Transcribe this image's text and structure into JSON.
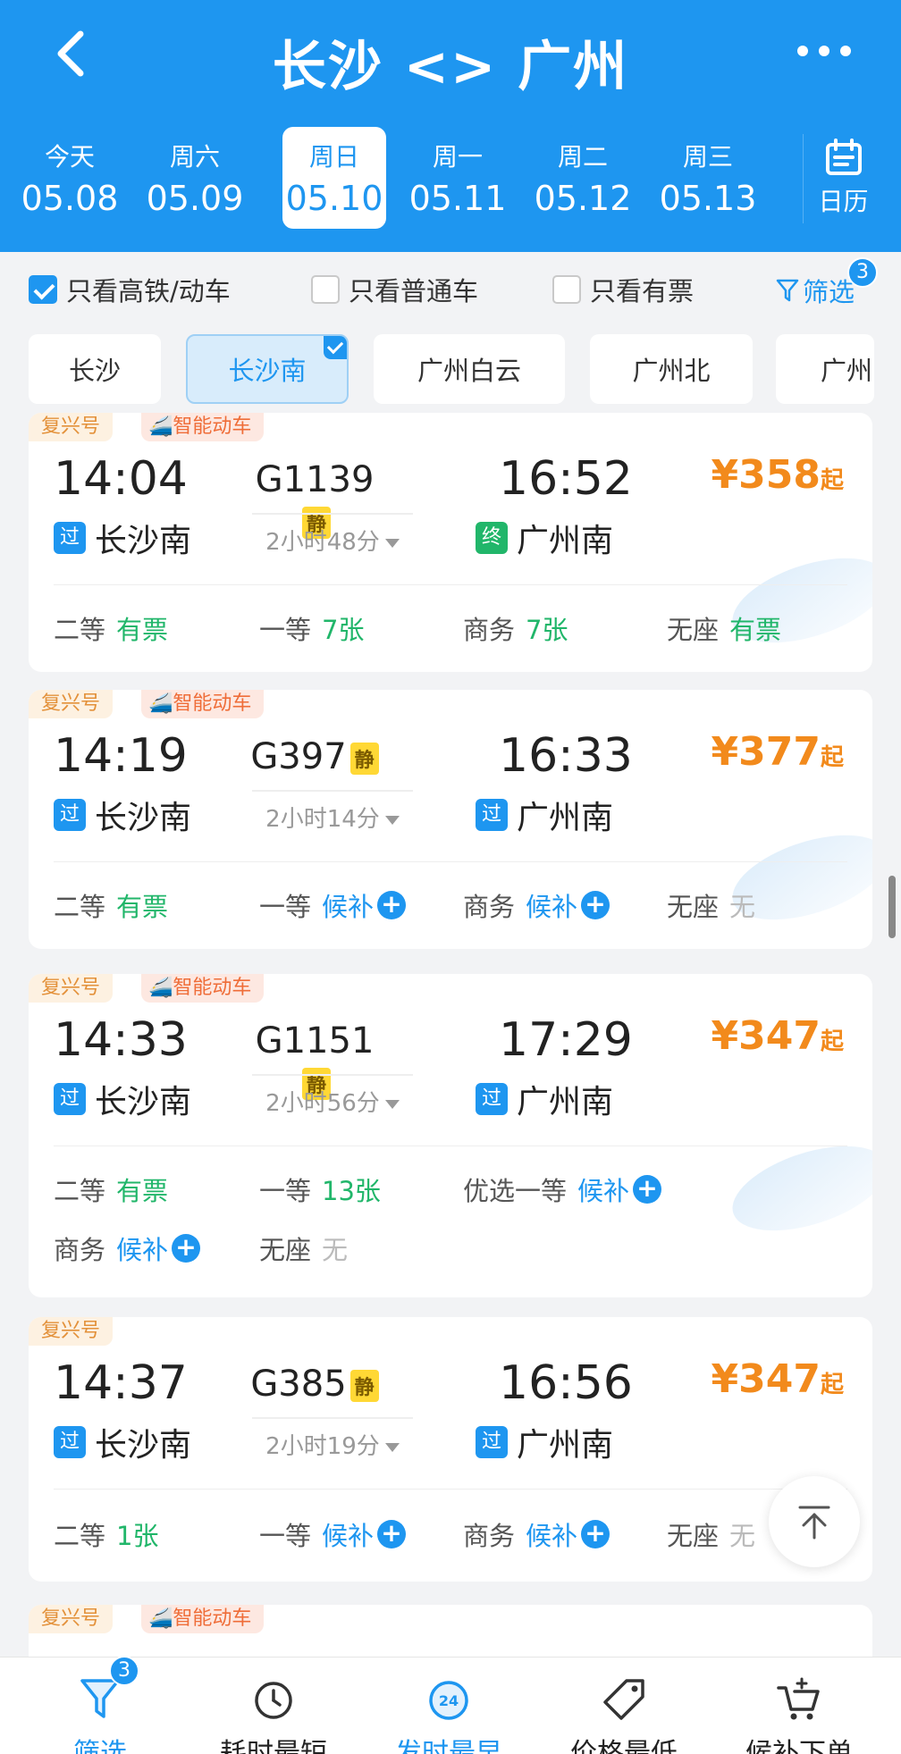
{
  "header": {
    "title": "长沙 <> 广州",
    "dates": [
      {
        "week": "今天",
        "date": "05.08",
        "active": false
      },
      {
        "week": "周六",
        "date": "05.09",
        "active": false
      },
      {
        "week": "周日",
        "date": "05.10",
        "active": true
      },
      {
        "week": "周一",
        "date": "05.11",
        "active": false
      },
      {
        "week": "周二",
        "date": "05.12",
        "active": false
      },
      {
        "week": "周三",
        "date": "05.13",
        "active": false
      }
    ],
    "calendar_label": "日历"
  },
  "filters": {
    "high_speed_label": "只看高铁/动车",
    "high_speed_checked": true,
    "normal_label": "只看普通车",
    "normal_checked": false,
    "available_label": "只看有票",
    "available_checked": false,
    "filter_label": "筛选",
    "filter_badge": "3"
  },
  "stations": [
    {
      "name": "长沙",
      "active": false
    },
    {
      "name": "长沙南",
      "active": true
    },
    {
      "name": "广州白云",
      "active": false
    },
    {
      "name": "广州北",
      "active": false
    },
    {
      "name": "广州",
      "active": false
    }
  ],
  "trains": [
    {
      "tags": [
        "复兴号",
        "智能动车"
      ],
      "dep_time": "14:04",
      "train_no": "G1139",
      "quiet": "静",
      "arr_time": "16:52",
      "duration": "2小时48分",
      "dep_mark": "过",
      "dep_station": "长沙南",
      "arr_mark": "终",
      "arr_station": "广州南",
      "price": "¥358",
      "price_suffix": "起",
      "seats": [
        {
          "class": "二等",
          "status": "有票"
        },
        {
          "class": "一等",
          "status": "7张"
        },
        {
          "class": "商务",
          "status": "7张"
        },
        {
          "class": "无座",
          "status": "有票"
        }
      ]
    },
    {
      "tags": [
        "复兴号",
        "智能动车"
      ],
      "dep_time": "14:19",
      "train_no": "G397",
      "quiet": "静",
      "arr_time": "16:33",
      "duration": "2小时14分",
      "dep_mark": "过",
      "dep_station": "长沙南",
      "arr_mark": "过",
      "arr_station": "广州南",
      "price": "¥377",
      "price_suffix": "起",
      "seats": [
        {
          "class": "二等",
          "status": "有票"
        },
        {
          "class": "一等",
          "status": "候补"
        },
        {
          "class": "商务",
          "status": "候补"
        },
        {
          "class": "无座",
          "status": "无"
        }
      ]
    },
    {
      "tags": [
        "复兴号",
        "智能动车"
      ],
      "dep_time": "14:33",
      "train_no": "G1151",
      "quiet": "静",
      "arr_time": "17:29",
      "duration": "2小时56分",
      "dep_mark": "过",
      "dep_station": "长沙南",
      "arr_mark": "过",
      "arr_station": "广州南",
      "price": "¥347",
      "price_suffix": "起",
      "seats": [
        {
          "class": "二等",
          "status": "有票"
        },
        {
          "class": "一等",
          "status": "13张"
        },
        {
          "class": "优选一等",
          "status": "候补"
        },
        {
          "class": "商务",
          "status": "候补"
        },
        {
          "class": "无座",
          "status": "无"
        }
      ]
    },
    {
      "tags": [
        "复兴号"
      ],
      "dep_time": "14:37",
      "train_no": "G385",
      "quiet": "静",
      "arr_time": "16:56",
      "duration": "2小时19分",
      "dep_mark": "过",
      "dep_station": "长沙南",
      "arr_mark": "过",
      "arr_station": "广州南",
      "price": "¥347",
      "price_suffix": "起",
      "seats": [
        {
          "class": "二等",
          "status": "1张"
        },
        {
          "class": "一等",
          "status": "候补"
        },
        {
          "class": "商务",
          "status": "候补"
        },
        {
          "class": "无座",
          "status": "无"
        }
      ]
    },
    {
      "tags": [
        "复兴号",
        "智能动车"
      ]
    }
  ],
  "bottom_nav": [
    {
      "label": "筛选",
      "icon": "filter-icon",
      "badge": "3",
      "active": true
    },
    {
      "label": "耗时最短",
      "icon": "clock-icon",
      "active": false
    },
    {
      "label": "发时最早",
      "icon": "24h-icon",
      "active": true
    },
    {
      "label": "价格最低",
      "icon": "price-tag-icon",
      "active": false
    },
    {
      "label": "候补下单",
      "icon": "cart-add-icon",
      "active": false
    }
  ],
  "colors": {
    "primary": "#1e96f0",
    "price": "#f28a1c",
    "available": "#21b66a"
  }
}
